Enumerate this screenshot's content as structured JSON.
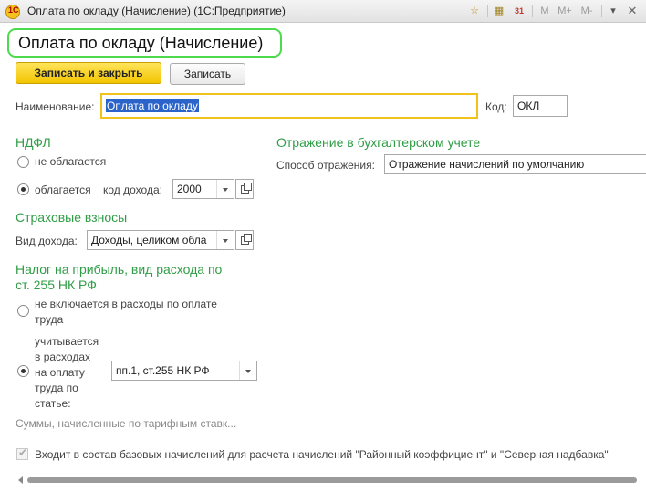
{
  "window": {
    "title": "Оплата по окладу (Начисление)  (1С:Предприятие)",
    "toolbar": {
      "m": "M",
      "m_plus": "M+",
      "m_minus": "M-",
      "calendar_day": "31"
    }
  },
  "form": {
    "title": "Оплата по окладу (Начисление)"
  },
  "buttons": {
    "save_close": "Записать и закрыть",
    "save": "Записать"
  },
  "name": {
    "label": "Наименование:",
    "value": "Оплата по окладу"
  },
  "code": {
    "label": "Код:",
    "value": "ОКЛ"
  },
  "ndfl": {
    "title": "НДФЛ",
    "opt_not_taxed": "не облагается",
    "opt_taxed": "облагается",
    "income_code_label": "код дохода:",
    "income_code": "2000",
    "selected": "облагается"
  },
  "insurance": {
    "title": "Страховые взносы",
    "income_type_label": "Вид дохода:",
    "income_type": "Доходы, целиком обла"
  },
  "profit_tax": {
    "title_line1": "Налог на прибыль, вид расхода по",
    "title_line2": "ст. 255 НК РФ",
    "opt_not_included_1": "не включается в расходы по оплате",
    "opt_not_included_2": "труда",
    "opt_included_lines": [
      "учитывается",
      "в расходах",
      "на оплату",
      "труда по",
      "статье:"
    ],
    "article": "пп.1, ст.255 НК РФ",
    "selected": "учитывается"
  },
  "tariff_link": "Суммы, начисленные по тарифным ставк...",
  "accounting": {
    "title": "Отражение в бухгалтерском учете",
    "method_label": "Способ отражения:",
    "method": "Отражение начислений по умолчанию"
  },
  "base_accruals": {
    "checked": true,
    "label": "Входит в состав базовых начислений для расчета начислений \"Районный коэффициент\" и \"Северная надбавка\""
  }
}
